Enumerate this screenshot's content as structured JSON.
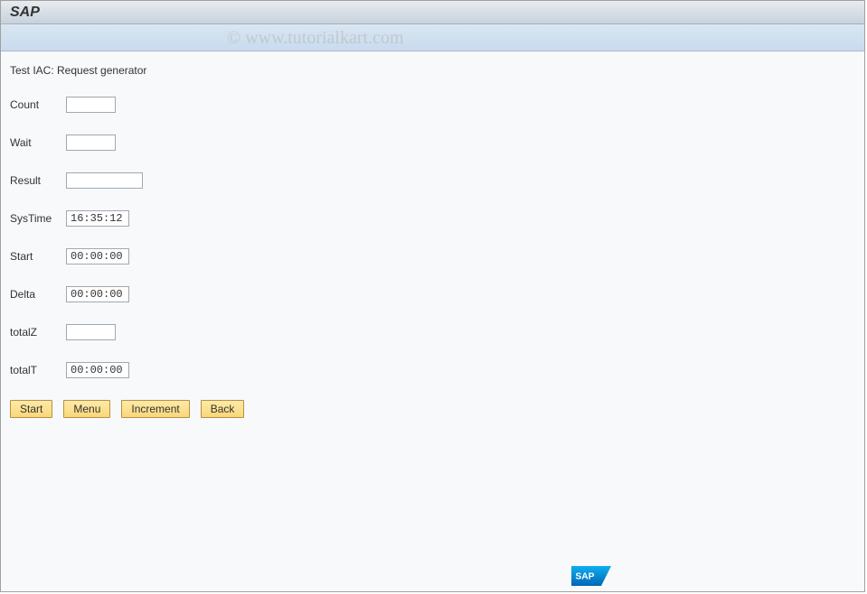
{
  "window": {
    "title": "SAP"
  },
  "watermark": "© www.tutorialkart.com",
  "page": {
    "title": "Test IAC: Request generator"
  },
  "fields": {
    "count": {
      "label": "Count",
      "value": ""
    },
    "wait": {
      "label": "Wait",
      "value": ""
    },
    "result": {
      "label": "Result",
      "value": ""
    },
    "systime": {
      "label": "SysTime",
      "value": "16:35:12"
    },
    "start": {
      "label": "Start",
      "value": "00:00:00"
    },
    "delta": {
      "label": "Delta",
      "value": "00:00:00"
    },
    "totalz": {
      "label": "totalZ",
      "value": ""
    },
    "totalt": {
      "label": "totalT",
      "value": "00:00:00"
    }
  },
  "buttons": {
    "start": "Start",
    "menu": "Menu",
    "increment": "Increment",
    "back": "Back"
  },
  "logo": "SAP"
}
